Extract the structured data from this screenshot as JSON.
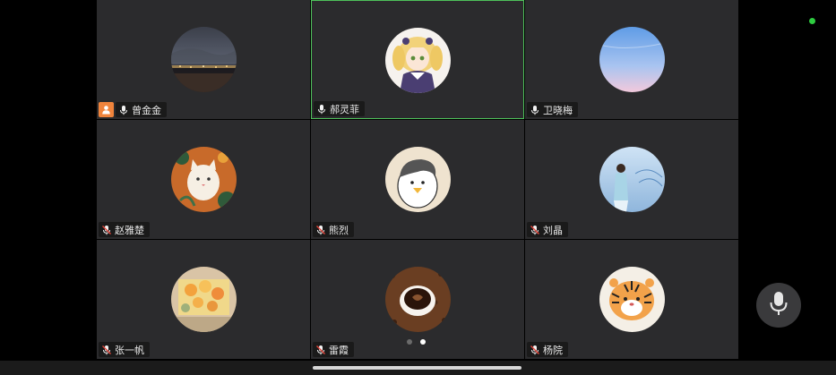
{
  "participants": [
    {
      "name": "曾金金",
      "host": true,
      "mic": "on",
      "active": false,
      "avatar": "city-night-photo"
    },
    {
      "name": "郝灵菲",
      "host": false,
      "mic": "on",
      "active": true,
      "avatar": "anime-girl-drawing"
    },
    {
      "name": "卫晓梅",
      "host": false,
      "mic": "on",
      "active": false,
      "avatar": "blue-sky-gradient"
    },
    {
      "name": "赵雅楚",
      "host": false,
      "mic": "muted",
      "active": false,
      "avatar": "white-cat-illustration"
    },
    {
      "name": "熊烈",
      "host": false,
      "mic": "muted",
      "active": false,
      "avatar": "cartoon-duck"
    },
    {
      "name": "刘晶",
      "host": false,
      "mic": "muted",
      "active": false,
      "avatar": "girl-on-beach-photo"
    },
    {
      "name": "张一帆",
      "host": false,
      "mic": "muted",
      "active": false,
      "avatar": "flower-bouquet-photo"
    },
    {
      "name": "雷霞",
      "host": false,
      "mic": "muted",
      "active": false,
      "avatar": "coffee-cup-photo"
    },
    {
      "name": "杨院",
      "host": false,
      "mic": "muted",
      "active": false,
      "avatar": "cartoon-tiger"
    }
  ],
  "pagination": {
    "total_pages": 2,
    "current_page": 2
  },
  "colors": {
    "tile_bg": "#2b2b2d",
    "active_border": "#4ec15a",
    "host_badge": "#f0843c",
    "muted_slash": "#e0443a",
    "status_dot": "#2ecc40"
  },
  "icons": {
    "host": "person-icon",
    "mic_on": "microphone-icon",
    "mic_muted": "microphone-muted-icon",
    "floating_mic": "microphone-icon"
  }
}
